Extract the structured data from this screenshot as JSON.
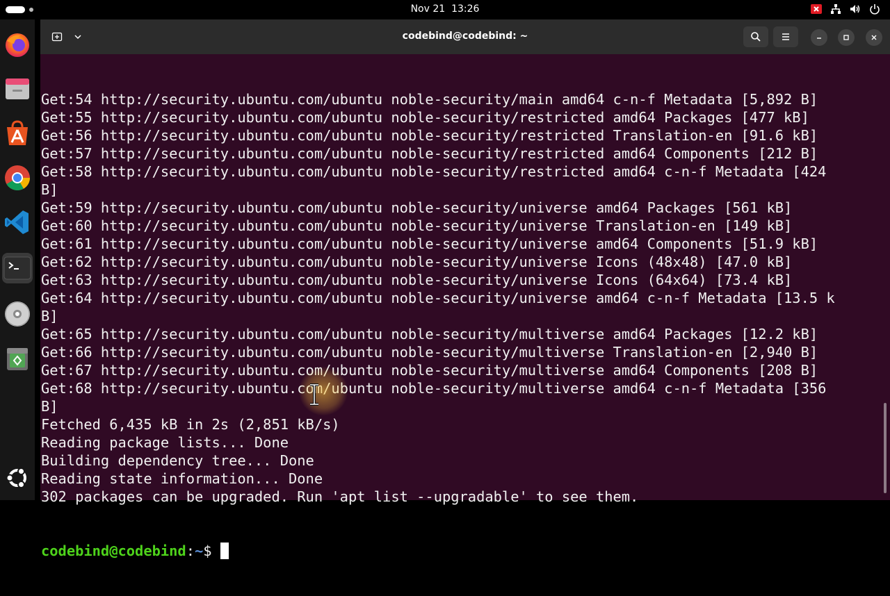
{
  "topbar": {
    "date": "Nov 21",
    "time": "13:26"
  },
  "dock": {
    "items": [
      {
        "name": "firefox",
        "icon": "firefox-icon"
      },
      {
        "name": "files",
        "icon": "files-icon"
      },
      {
        "name": "app-center",
        "icon": "app-center-icon"
      },
      {
        "name": "chrome",
        "icon": "chrome-icon"
      },
      {
        "name": "vscode",
        "icon": "vscode-icon"
      },
      {
        "name": "terminal",
        "icon": "terminal-icon",
        "active": true
      },
      {
        "name": "disc",
        "icon": "disc-icon"
      },
      {
        "name": "trash",
        "icon": "trash-icon"
      },
      {
        "name": "show-apps",
        "icon": "ubuntu-logo-icon"
      }
    ]
  },
  "window": {
    "title": "codebind@codebind: ~"
  },
  "terminal": {
    "lines": [
      "Get:54 http://security.ubuntu.com/ubuntu noble-security/main amd64 c-n-f Metadata [5,892 B]",
      "Get:55 http://security.ubuntu.com/ubuntu noble-security/restricted amd64 Packages [477 kB]",
      "Get:56 http://security.ubuntu.com/ubuntu noble-security/restricted Translation-en [91.6 kB]",
      "Get:57 http://security.ubuntu.com/ubuntu noble-security/restricted amd64 Components [212 B]",
      "Get:58 http://security.ubuntu.com/ubuntu noble-security/restricted amd64 c-n-f Metadata [424",
      "B]",
      "Get:59 http://security.ubuntu.com/ubuntu noble-security/universe amd64 Packages [561 kB]",
      "Get:60 http://security.ubuntu.com/ubuntu noble-security/universe Translation-en [149 kB]",
      "Get:61 http://security.ubuntu.com/ubuntu noble-security/universe amd64 Components [51.9 kB]",
      "Get:62 http://security.ubuntu.com/ubuntu noble-security/universe Icons (48x48) [47.0 kB]",
      "Get:63 http://security.ubuntu.com/ubuntu noble-security/universe Icons (64x64) [73.4 kB]",
      "Get:64 http://security.ubuntu.com/ubuntu noble-security/universe amd64 c-n-f Metadata [13.5 k",
      "B]",
      "Get:65 http://security.ubuntu.com/ubuntu noble-security/multiverse amd64 Packages [12.2 kB]",
      "Get:66 http://security.ubuntu.com/ubuntu noble-security/multiverse Translation-en [2,940 B]",
      "Get:67 http://security.ubuntu.com/ubuntu noble-security/multiverse amd64 Components [208 B]",
      "Get:68 http://security.ubuntu.com/ubuntu noble-security/multiverse amd64 c-n-f Metadata [356",
      "B]",
      "Fetched 6,435 kB in 2s (2,851 kB/s)",
      "Reading package lists... Done",
      "Building dependency tree... Done",
      "Reading state information... Done",
      "302 packages can be upgraded. Run 'apt list --upgradable' to see them."
    ],
    "prompt": {
      "user_host": "codebind@codebind",
      "separator": ":",
      "path": "~",
      "symbol": "$ "
    }
  },
  "colors": {
    "terminal_bg": "#300a24",
    "prompt_user": "#4ed31b",
    "prompt_path": "#5b8ed6",
    "headerbar": "#2c2c2c"
  }
}
